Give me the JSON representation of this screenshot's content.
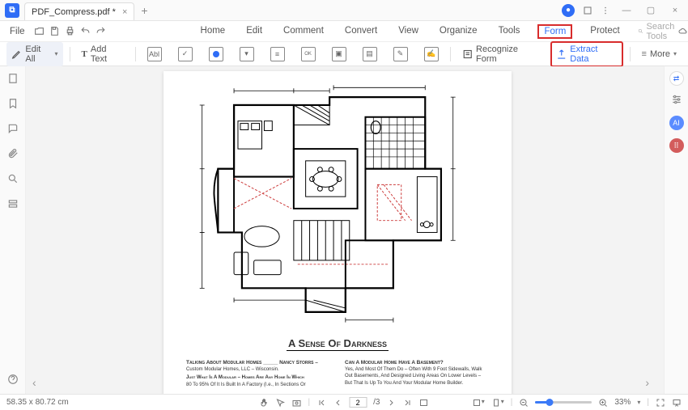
{
  "title": {
    "filename": "PDF_Compress.pdf *"
  },
  "menu": {
    "file": "File",
    "items": [
      "Home",
      "Edit",
      "Comment",
      "Convert",
      "View",
      "Organize",
      "Tools",
      "Form",
      "Protect"
    ],
    "active": "Form",
    "search_placeholder": "Search Tools"
  },
  "ribbon": {
    "edit_all": "Edit All",
    "add_text": "Add Text",
    "recognize": "Recognize Form",
    "extract": "Extract Data",
    "more": "More",
    "icon_abbr": {
      "text": "Abl",
      "check": "✓",
      "radio": "●",
      "combo": "▾",
      "list": "≡",
      "button": "OK",
      "image": "▣",
      "date": "▤",
      "sig": "✎",
      "sig2": "✍"
    }
  },
  "doc": {
    "title": "A Sense Of Darkness",
    "left_col": {
      "heading": "Talking About Modular Homes _____ Nancy Storrs –",
      "sub": "Custom Modular Homes, LLC – Wisconsin.",
      "q": "Just What Is A Modular – Homes Are Any Home In Which",
      "body": "80 To 95% Of It Is Built In A Factory (I.e., In Sections Or"
    },
    "right_col": {
      "heading": "Can A Modular Home Have A Basement?",
      "body1": "Yes, And Most Of Them Do – Often With 9 Foot Sidewalls, Walk",
      "body2": "Out Basements, And Designed Living Areas On Lower Levels –",
      "body3": "But That Is Up To You And Your Modular Home Builder."
    }
  },
  "pager": {
    "current": "2",
    "total": "/3"
  },
  "footer": {
    "dimensions": "58.35 x 80.72 cm",
    "zoom": "33%"
  }
}
